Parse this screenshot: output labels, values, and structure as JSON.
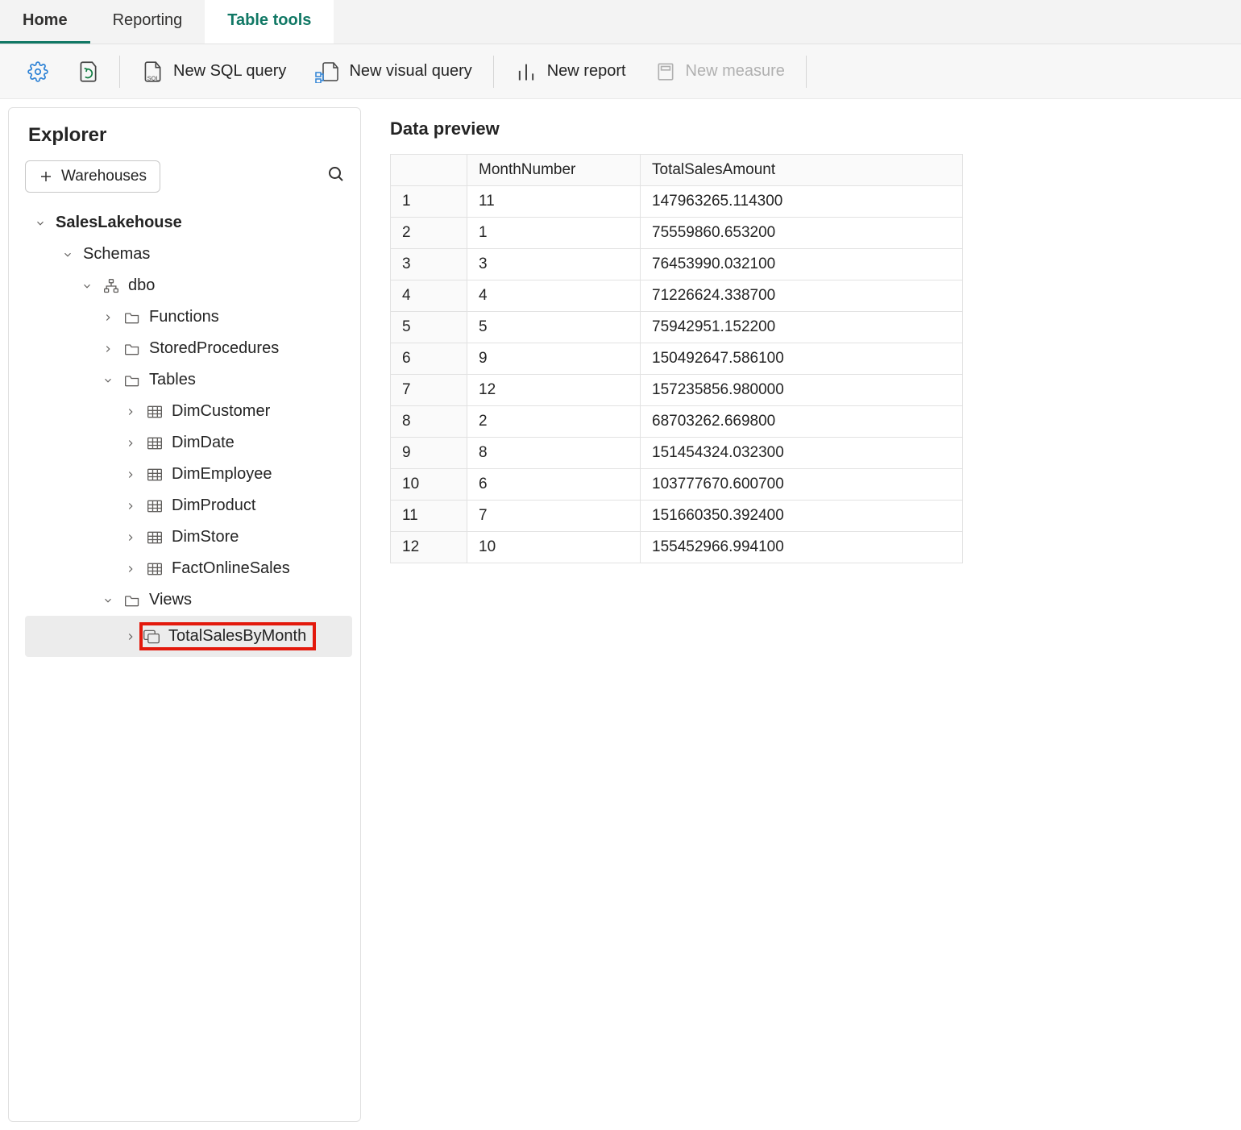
{
  "tabs": {
    "home": "Home",
    "reporting": "Reporting",
    "tabletools": "Table tools"
  },
  "toolbar": {
    "new_sql": "New SQL query",
    "new_visual": "New visual query",
    "new_report": "New report",
    "new_measure": "New measure"
  },
  "explorer": {
    "title": "Explorer",
    "warehouses_btn": "Warehouses",
    "tree": {
      "database": "SalesLakehouse",
      "schemas_label": "Schemas",
      "schema": "dbo",
      "functions": "Functions",
      "sprocs": "StoredProcedures",
      "tables_label": "Tables",
      "tables": [
        "DimCustomer",
        "DimDate",
        "DimEmployee",
        "DimProduct",
        "DimStore",
        "FactOnlineSales"
      ],
      "views_label": "Views",
      "view_selected": "TotalSalesByMonth"
    }
  },
  "preview": {
    "title": "Data preview",
    "columns": [
      "MonthNumber",
      "TotalSalesAmount"
    ],
    "rows": [
      {
        "n": "1",
        "month": "11",
        "amount": "147963265.114300"
      },
      {
        "n": "2",
        "month": "1",
        "amount": "75559860.653200"
      },
      {
        "n": "3",
        "month": "3",
        "amount": "76453990.032100"
      },
      {
        "n": "4",
        "month": "4",
        "amount": "71226624.338700"
      },
      {
        "n": "5",
        "month": "5",
        "amount": "75942951.152200"
      },
      {
        "n": "6",
        "month": "9",
        "amount": "150492647.586100"
      },
      {
        "n": "7",
        "month": "12",
        "amount": "157235856.980000"
      },
      {
        "n": "8",
        "month": "2",
        "amount": "68703262.669800"
      },
      {
        "n": "9",
        "month": "8",
        "amount": "151454324.032300"
      },
      {
        "n": "10",
        "month": "6",
        "amount": "103777670.600700"
      },
      {
        "n": "11",
        "month": "7",
        "amount": "151660350.392400"
      },
      {
        "n": "12",
        "month": "10",
        "amount": "155452966.994100"
      }
    ]
  }
}
